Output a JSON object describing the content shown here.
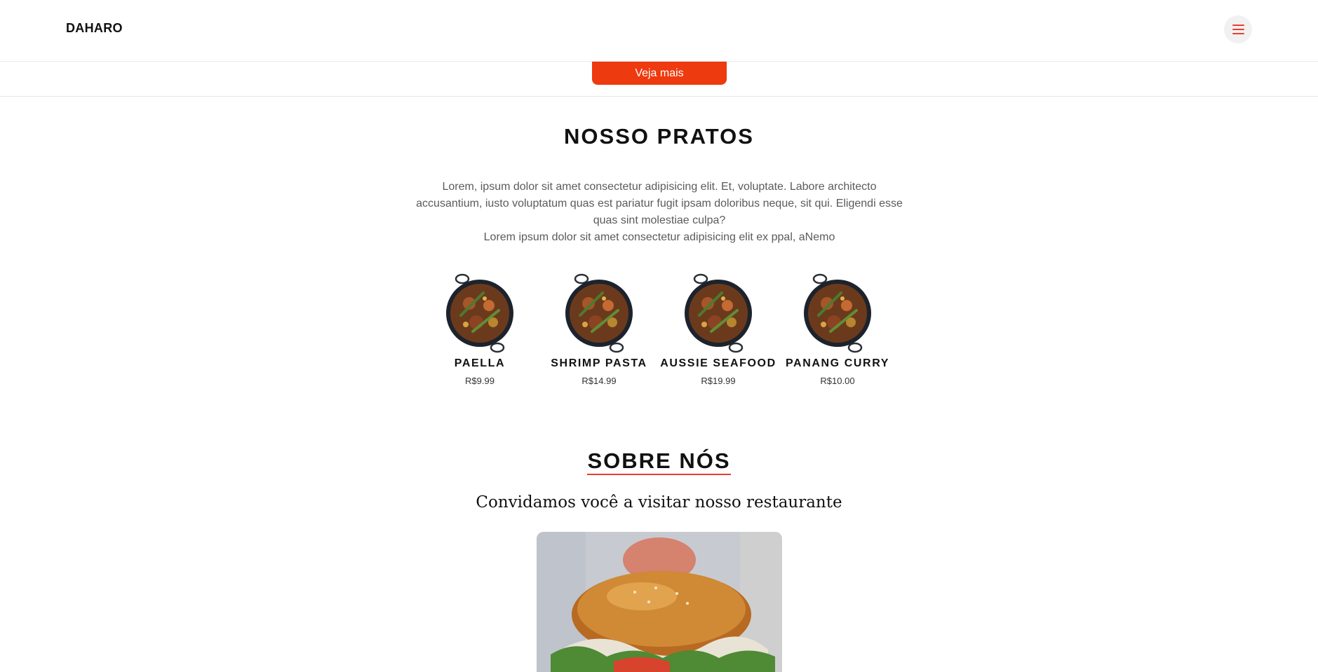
{
  "header": {
    "logo": "DAHARO",
    "menu_icon": "hamburger-icon",
    "accent": "#ea3d2f"
  },
  "hero": {
    "cta_label": "Veja mais",
    "cta_color": "#ee3a0f"
  },
  "pratos": {
    "title": "NOSSO PRATOS",
    "description": [
      "Lorem, ipsum dolor sit amet consectetur adipisicing elit. Et, voluptate. Labore architecto",
      "accusantium, iusto voluptatum quas est pariatur fugit ipsam doloribus neque, sit qui. Eligendi esse",
      "quas sint molestiae culpa?",
      "Lorem ipsum dolor sit amet consectetur adipisicing elit ex ppal, aNemo"
    ],
    "dishes": [
      {
        "name": "PAELLA",
        "price": "R$9.99"
      },
      {
        "name": "SHRIMP PASTA",
        "price": "R$14.99"
      },
      {
        "name": "AUSSIE SEAFOOD",
        "price": "R$19.99"
      },
      {
        "name": "PANANG CURRY",
        "price": "R$10.00"
      }
    ]
  },
  "sobre": {
    "title": "SOBRE NÓS",
    "tagline": "Convidamos você a visitar nosso restaurante"
  }
}
